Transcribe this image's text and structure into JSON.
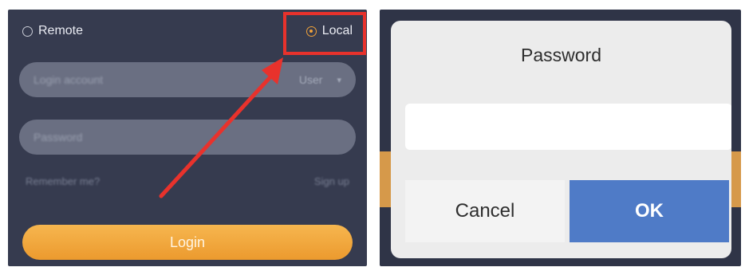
{
  "login_panel": {
    "radio_remote_label": "Remote",
    "radio_local_label": "Local",
    "selected_mode": "Local",
    "account_placeholder": "Login account",
    "user_select_label": "User",
    "password_placeholder": "Password",
    "remember_label": "Remember me?",
    "signup_label": "Sign up",
    "login_button_label": "Login",
    "highlight_color": "#e8322c"
  },
  "password_dialog": {
    "title": "Password",
    "input_value": "",
    "cancel_label": "Cancel",
    "ok_label": "OK",
    "ok_color": "#4f7bc7"
  }
}
